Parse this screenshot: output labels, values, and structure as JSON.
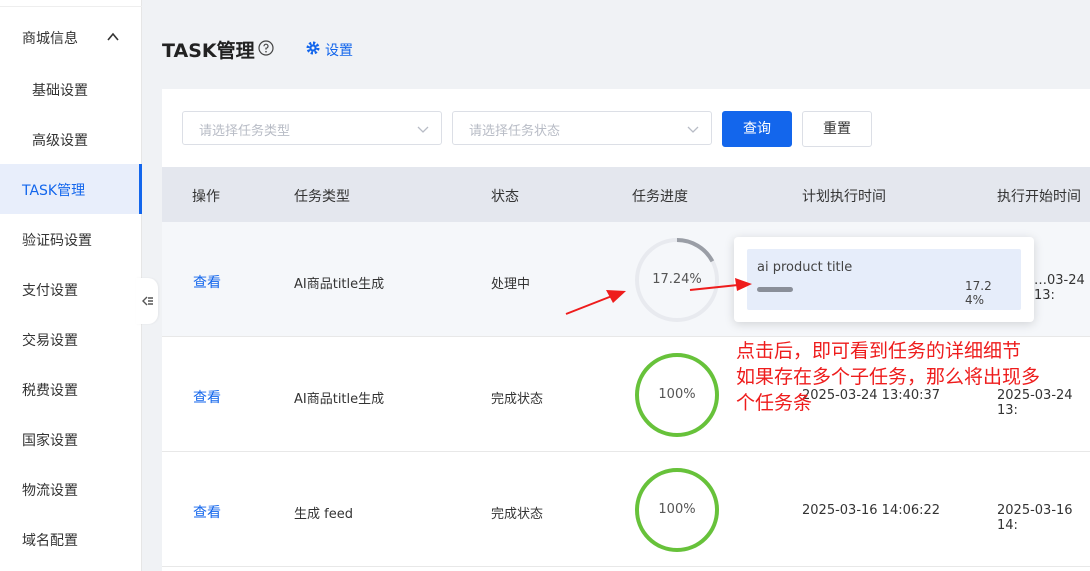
{
  "sidebar": {
    "group_label": "商城信息",
    "items": [
      {
        "label": "基础设置",
        "sub": true
      },
      {
        "label": "高级设置",
        "sub": true
      },
      {
        "label": "TASK管理",
        "active": true
      },
      {
        "label": "验证码设置"
      },
      {
        "label": "支付设置"
      },
      {
        "label": "交易设置"
      },
      {
        "label": "税费设置"
      },
      {
        "label": "国家设置"
      },
      {
        "label": "物流设置"
      },
      {
        "label": "域名配置"
      }
    ]
  },
  "header": {
    "title": "TASK管理",
    "settings_label": "设置"
  },
  "filters": {
    "task_type_placeholder": "请选择任务类型",
    "task_status_placeholder": "请选择任务状态",
    "query_label": "查询",
    "reset_label": "重置"
  },
  "table": {
    "columns": [
      "操作",
      "任务类型",
      "状态",
      "任务进度",
      "计划执行时间",
      "执行开始时间"
    ],
    "rows": [
      {
        "action": "查看",
        "type": "AI商品title生成",
        "status": "处理中",
        "progress": 17.24,
        "progress_label": "17.24%",
        "planned_time": "",
        "start_time": "…03-24 13:"
      },
      {
        "action": "查看",
        "type": "AI商品title生成",
        "status": "完成状态",
        "progress": 100,
        "progress_label": "100%",
        "planned_time": "2025-03-24 13:40:37",
        "start_time": "2025-03-24 13:"
      },
      {
        "action": "查看",
        "type": "生成 feed",
        "status": "完成状态",
        "progress": 100,
        "progress_label": "100%",
        "planned_time": "2025-03-16 14:06:22",
        "start_time": "2025-03-16 14:"
      }
    ]
  },
  "popover": {
    "subtask_title": "ai product title",
    "subtask_value": "17.24%",
    "subtask_progress": 17.24
  },
  "annotation": {
    "text": "点击后，即可看到任务的详细细节\n如果存在多个子任务，那么将出现多\n个任务条"
  },
  "colors": {
    "primary": "#1366ec",
    "complete": "#67c23a",
    "track": "#e8eaef",
    "processing": "#9a9ea6",
    "annotation": "#ee1c1c"
  }
}
